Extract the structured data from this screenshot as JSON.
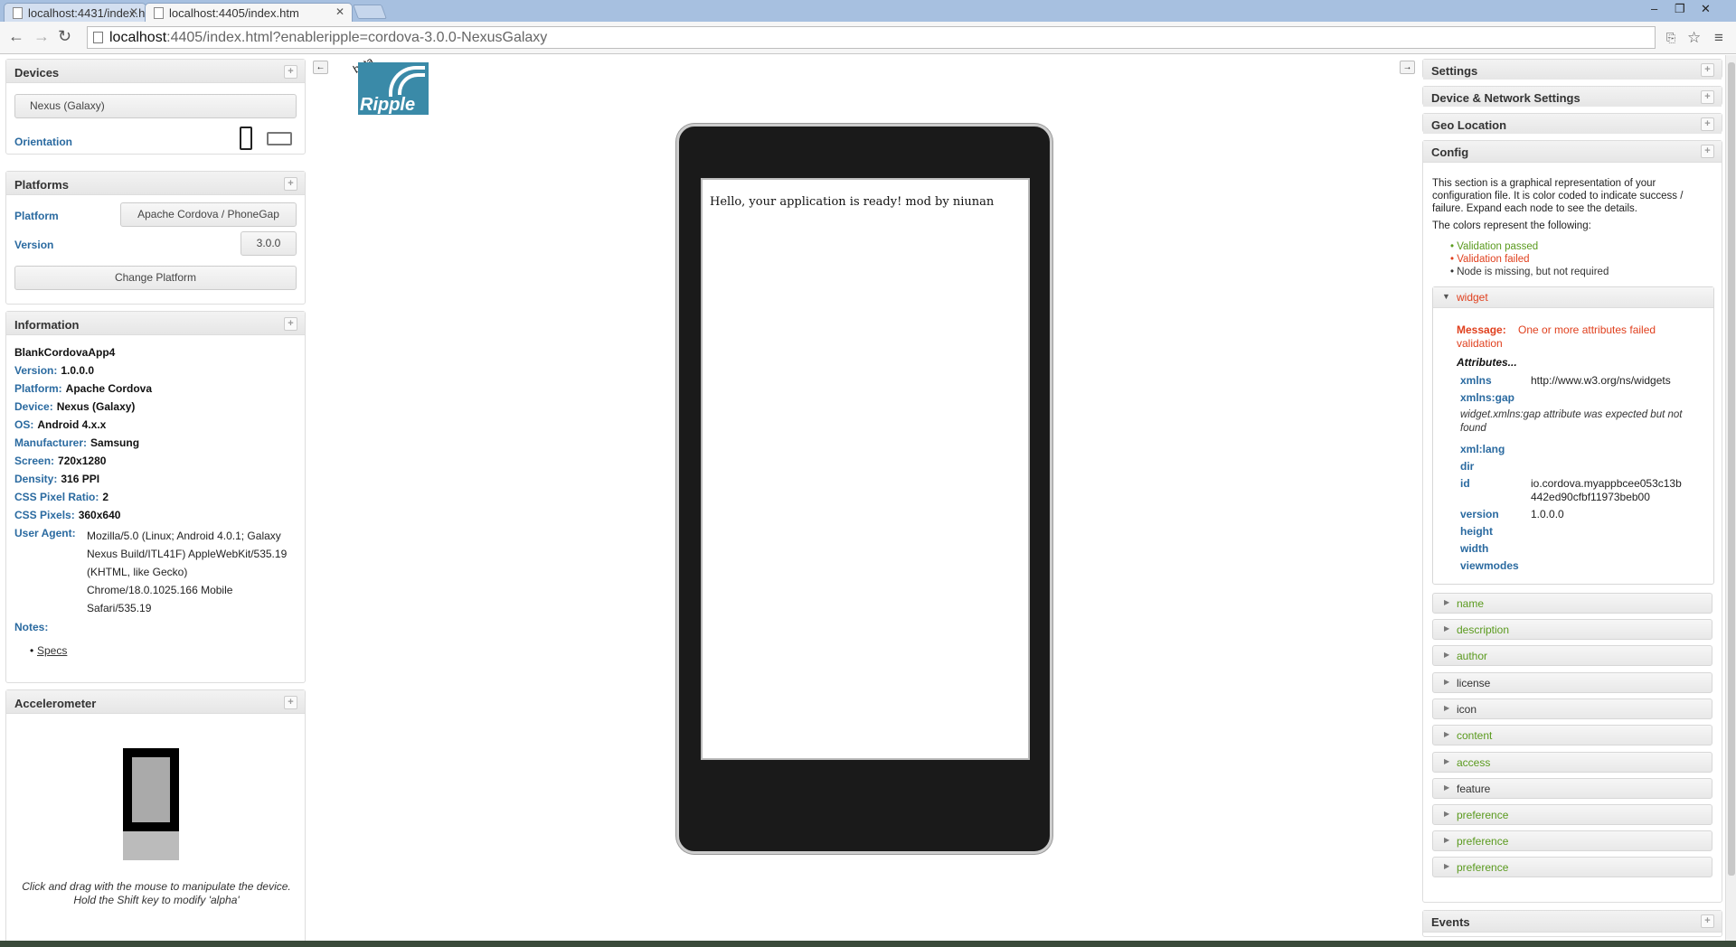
{
  "browser": {
    "tabs": [
      {
        "title": "localhost:4431/index.htm"
      },
      {
        "title": "localhost:4405/index.htm"
      }
    ],
    "url_host": "localhost",
    "url_rest": ":4405/index.html?enableripple=cordova-3.0.0-NexusGalaxy"
  },
  "logo": {
    "beta": "beta",
    "name": "Ripple"
  },
  "devices": {
    "title": "Devices",
    "selected": "Nexus (Galaxy)",
    "orientation_label": "Orientation"
  },
  "platforms": {
    "title": "Platforms",
    "platform_label": "Platform",
    "platform_value": "Apache Cordova / PhoneGap",
    "version_label": "Version",
    "version_value": "3.0.0",
    "change_button": "Change Platform"
  },
  "information": {
    "title": "Information",
    "app_name": "BlankCordovaApp4",
    "version_k": "Version:",
    "version_v": "1.0.0.0",
    "platform_k": "Platform:",
    "platform_v": "Apache Cordova",
    "device_k": "Device:",
    "device_v": "Nexus (Galaxy)",
    "os_k": "OS:",
    "os_v": "Android 4.x.x",
    "manufacturer_k": "Manufacturer:",
    "manufacturer_v": "Samsung",
    "screen_k": "Screen:",
    "screen_v": "720x1280",
    "density_k": "Density:",
    "density_v": "316 PPI",
    "cssratio_k": "CSS Pixel Ratio:",
    "cssratio_v": "2",
    "csspixels_k": "CSS Pixels:",
    "csspixels_v": "360x640",
    "ua_k": "User Agent:",
    "ua_lines": [
      "Mozilla/5.0 (Linux; Android 4.0.1; Galaxy",
      "Nexus Build/ITL41F) AppleWebKit/535.19",
      "(KHTML, like Gecko)",
      "Chrome/18.0.1025.166 Mobile",
      "Safari/535.19"
    ],
    "notes_k": "Notes:",
    "specs_link": "Specs"
  },
  "accelerometer": {
    "title": "Accelerometer",
    "hint_line1": "Click and drag with the mouse to manipulate the device.",
    "hint_line2": "Hold the Shift key to modify 'alpha'"
  },
  "app_screen": {
    "text": "Hello, your application is ready! mod by niunan"
  },
  "right": {
    "settings": "Settings",
    "device_network": "Device & Network Settings",
    "geo": "Geo Location",
    "config": "Config",
    "events": "Events",
    "config_desc": "This section is a graphical representation of your configuration file. It is color coded to indicate success / failure. Expand each node to see the details.",
    "colors_intro": "The colors represent the following:",
    "legend_passed": "Validation passed",
    "legend_failed": "Validation failed",
    "legend_missing": "Node is missing, but not required",
    "widget_title": "widget",
    "message_k": "Message:",
    "message_v": "One or more attributes failed validation",
    "attributes_title": "Attributes...",
    "attrs": {
      "xmlns_k": "xmlns",
      "xmlns_v": "http://www.w3.org/ns/widgets",
      "xmlnsgap_k": "xmlns:gap",
      "xmlnsgap_note": "widget.xmlns:gap attribute was expected but not found",
      "xmllang_k": "xml:lang",
      "dir_k": "dir",
      "id_k": "id",
      "id_v1": "io.cordova.myappbcee053c13b",
      "id_v2": "442ed90cfbf11973beb00",
      "version_k": "version",
      "version_v": "1.0.0.0",
      "height_k": "height",
      "width_k": "width",
      "viewmodes_k": "viewmodes"
    },
    "nodes": [
      "name",
      "description",
      "author",
      "license",
      "icon",
      "content",
      "access",
      "feature",
      "preference",
      "preference",
      "preference"
    ]
  },
  "colors": {
    "passed": "#5a9a1e",
    "failed": "#e0401e",
    "label": "#2a6aa0"
  }
}
